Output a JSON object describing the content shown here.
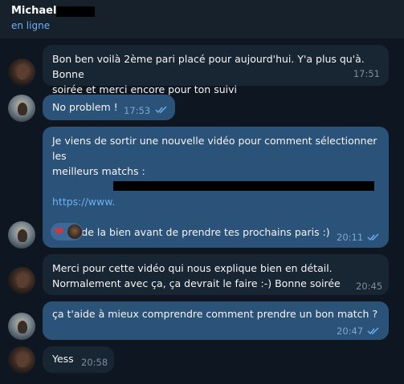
{
  "header": {
    "contact_name": "Michael",
    "status": "en ligne"
  },
  "messages": [
    {
      "dir": "in",
      "lines": [
        "Bon ben voilà 2ème pari placé pour aujourd'hui. Y'a plus qu'à. Bonne",
        "soirée et merci encore pour ton suivi"
      ],
      "time": "17:51"
    },
    {
      "dir": "out",
      "lines": [
        "No problem !"
      ],
      "time": "17:53",
      "read": true
    },
    {
      "dir": "out",
      "lines": [
        "Je viens de sortir une nouvelle vidéo pour comment sélectionner les",
        "meilleurs matchs :",
        "",
        "https://www.",
        "",
        "Regarde la bien avant de prendre tes prochains paris :)"
      ],
      "time": "20:11",
      "read": true,
      "reaction": "❤"
    },
    {
      "dir": "in",
      "lines": [
        "Merci pour cette vidéo qui nous explique bien en détail.",
        "Normalement avec ça, ça devrait le faire :-) Bonne soirée"
      ],
      "time": "20:45"
    },
    {
      "dir": "out",
      "lines": [
        "ça t'aide à mieux comprendre comment prendre un bon match ?"
      ],
      "time": "20:47",
      "read": true
    },
    {
      "dir": "in",
      "lines": [
        "Yess"
      ],
      "time": "20:58"
    }
  ],
  "colors": {
    "background": "#0e1621",
    "header": "#17212b",
    "incoming_bubble": "#182533",
    "outgoing_bubble": "#2b5278",
    "accent": "#6ab2f2",
    "link": "#6ab3f3"
  }
}
